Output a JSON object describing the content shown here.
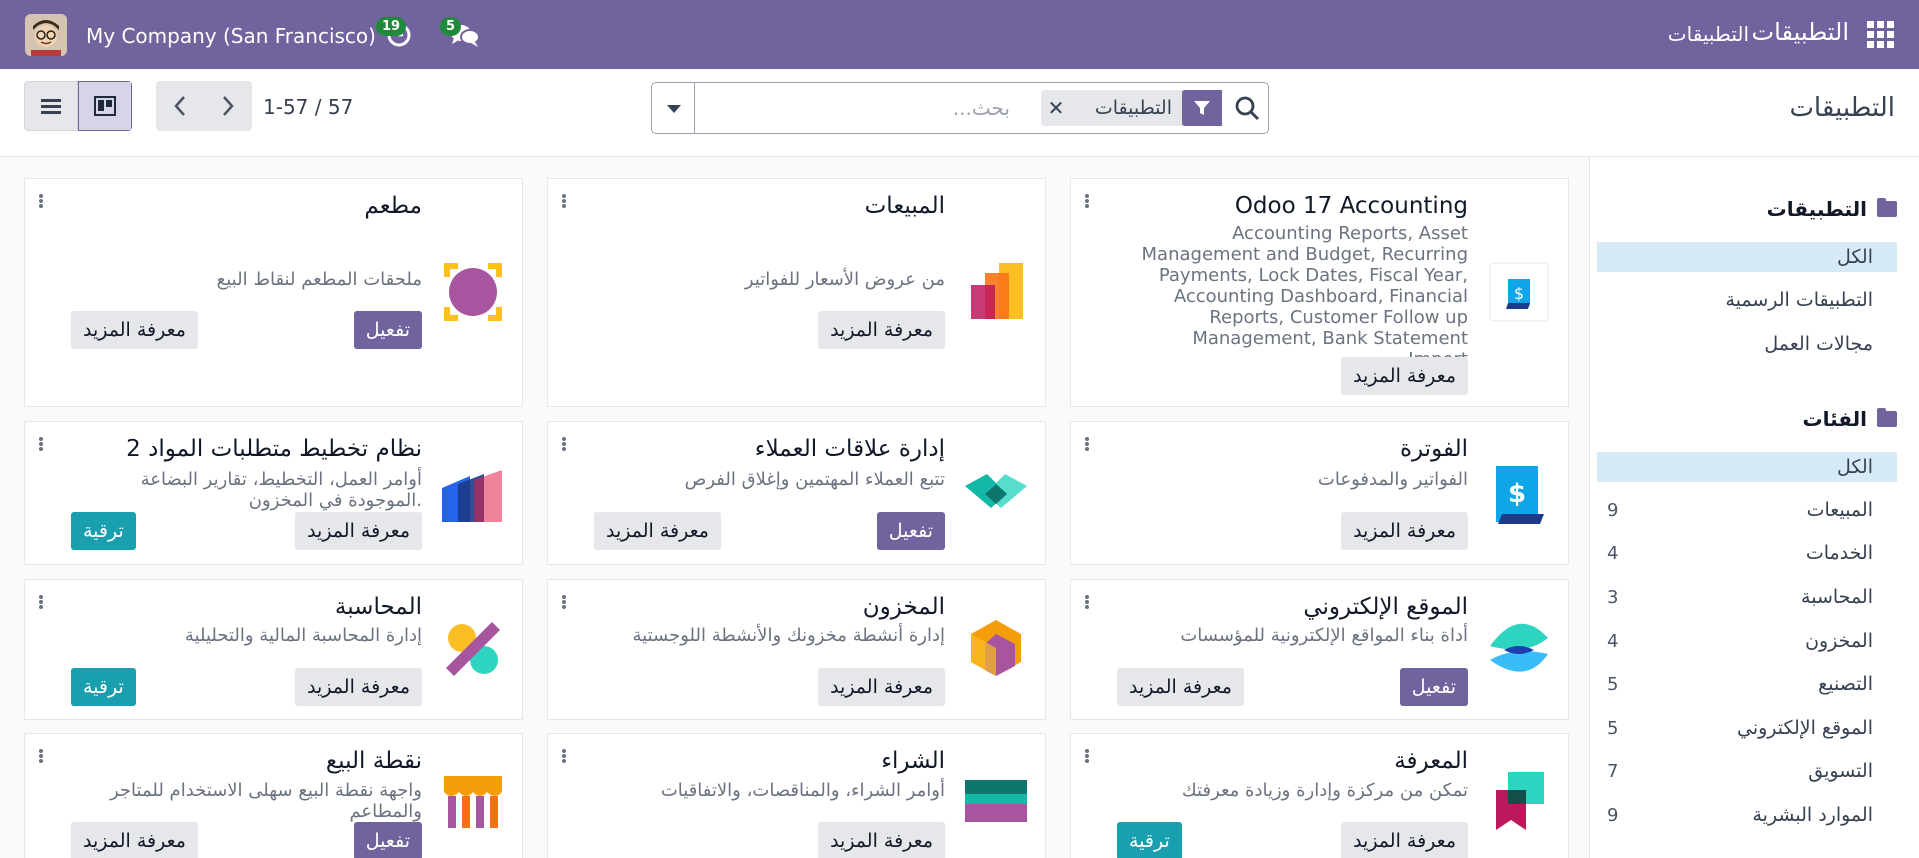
{
  "navbar": {
    "brand": "التطبيقات",
    "menu": "التطبيقات",
    "company": "My Company (San Francisco)",
    "activity_count": "19",
    "messages_count": "5"
  },
  "control": {
    "title": "التطبيقات",
    "search_placeholder": "بحث...",
    "facet_label": "التطبيقات",
    "pager": "1-57 / 57"
  },
  "sidebar": {
    "apps_header": "التطبيقات",
    "apps_items": [
      "الكل",
      "التطبيقات الرسمية",
      "مجالات العمل"
    ],
    "categories_header": "الفئات",
    "categories": [
      {
        "label": "الكل",
        "count": ""
      },
      {
        "label": "المبيعات",
        "count": "9"
      },
      {
        "label": "الخدمات",
        "count": "4"
      },
      {
        "label": "المحاسبة",
        "count": "3"
      },
      {
        "label": "المخزون",
        "count": "4"
      },
      {
        "label": "التصنيع",
        "count": "5"
      },
      {
        "label": "الموقع الإلكتروني",
        "count": "5"
      },
      {
        "label": "التسويق",
        "count": "7"
      },
      {
        "label": "الموارد البشرية",
        "count": "9"
      }
    ]
  },
  "buttons": {
    "learn": "معرفة المزيد",
    "activate": "تفعيل",
    "upgrade": "ترقية"
  },
  "cards": [
    {
      "title": "Odoo 17 Accounting",
      "desc": "Accounting Reports, Asset Management and Budget, Recurring Payments, Lock Dates, Fiscal Year, Accounting Dashboard, Financial Reports, Customer Follow up Management, Bank Statement Import",
      "icon": "accounting-dollar-icon"
    },
    {
      "title": "المبيعات",
      "desc": "من عروض الأسعار للفواتير",
      "icon": "sales-icon"
    },
    {
      "title": "مطعم",
      "desc": "ملحقات المطعم لنقاط البيع",
      "icon": "restaurant-icon"
    },
    {
      "title": "الفوترة",
      "desc": "الفواتير والمدفوعات",
      "icon": "invoicing-icon"
    },
    {
      "title": "إدارة علاقات العملاء",
      "desc": "تتبع العملاء المهتمين وإغلاق الفرص",
      "icon": "crm-icon"
    },
    {
      "title": "نظام تخطيط متطلبات المواد 2",
      "desc": "أوامر العمل، التخطيط، تقارير البضاعة الموجودة في المخزون.",
      "icon": "mrp-icon"
    },
    {
      "title": "الموقع الإلكتروني",
      "desc": "أداة بناء المواقع الإلكترونية للمؤسسات",
      "icon": "website-icon"
    },
    {
      "title": "المخزون",
      "desc": "إدارة أنشطة مخزونك والأنشطة اللوجستية",
      "icon": "inventory-icon"
    },
    {
      "title": "المحاسبة",
      "desc": "إدارة المحاسبة المالية والتحليلية",
      "icon": "accounting-icon"
    },
    {
      "title": "المعرفة",
      "desc": "تمكن من مركزة وإدارة وزيادة معرفتك",
      "icon": "knowledge-icon"
    },
    {
      "title": "الشراء",
      "desc": "أوامر الشراء، والمناقصات، والاتفاقيات",
      "icon": "purchase-icon"
    },
    {
      "title": "نقطة البيع",
      "desc": "واجهة نقطة البيع سهلى الاستخدام للمتاجر والمطاعم",
      "icon": "pos-icon"
    }
  ],
  "colors": {
    "navbar": "#71639e",
    "activate": "#71639e",
    "upgrade": "#1a9fae",
    "active_filter": "#d6ebf6"
  }
}
